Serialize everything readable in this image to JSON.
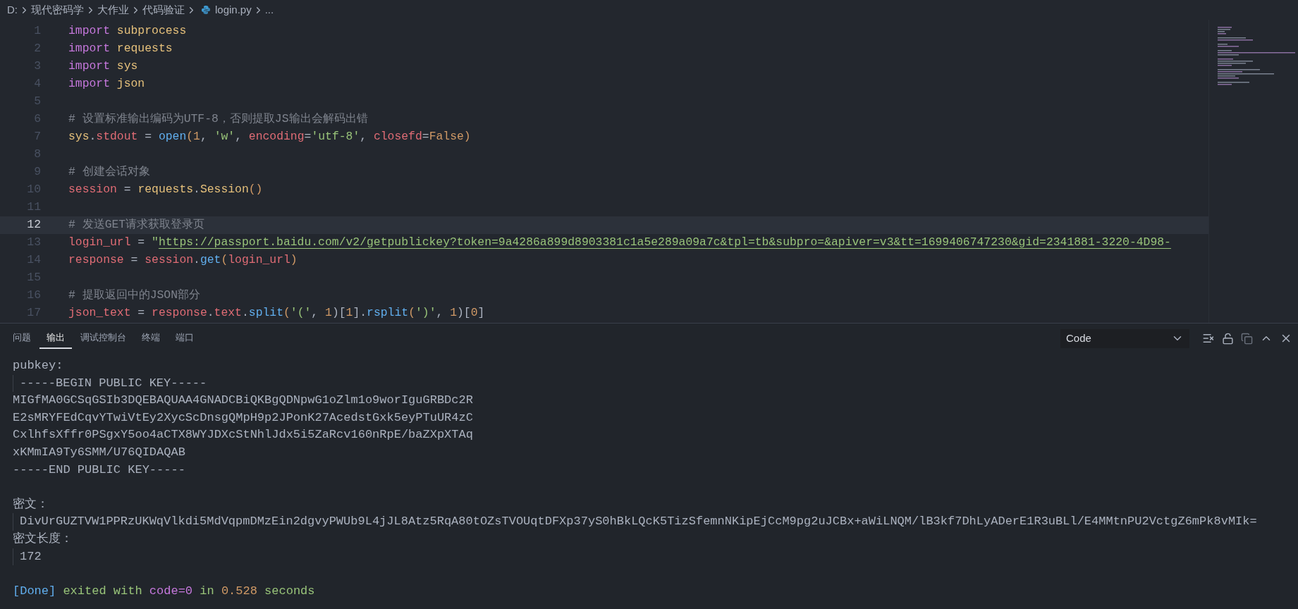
{
  "breadcrumb": [
    {
      "kind": "folder",
      "text": "D:"
    },
    {
      "kind": "folder",
      "text": "现代密码学"
    },
    {
      "kind": "folder",
      "text": "大作业"
    },
    {
      "kind": "folder",
      "text": "代码验证"
    },
    {
      "kind": "python-file",
      "text": "login.py"
    },
    {
      "kind": "more",
      "text": "..."
    }
  ],
  "code_lines": [
    {
      "number": "1",
      "current": false,
      "tokens": [
        {
          "kind": "keyword",
          "text": "import "
        },
        {
          "kind": "module",
          "text": "subprocess"
        }
      ]
    },
    {
      "number": "2",
      "current": false,
      "tokens": [
        {
          "kind": "keyword",
          "text": "import "
        },
        {
          "kind": "module",
          "text": "requests"
        }
      ]
    },
    {
      "number": "3",
      "current": false,
      "tokens": [
        {
          "kind": "keyword",
          "text": "import "
        },
        {
          "kind": "module",
          "text": "sys"
        }
      ]
    },
    {
      "number": "4",
      "current": false,
      "tokens": [
        {
          "kind": "keyword",
          "text": "import "
        },
        {
          "kind": "module",
          "text": "json"
        }
      ]
    },
    {
      "number": "5",
      "current": false
    },
    {
      "number": "6",
      "current": false,
      "tokens": [
        {
          "kind": "comment",
          "text": "# 设置标准输出编码为UTF-8，否则提取JS输出会解码出错"
        }
      ]
    },
    {
      "number": "7",
      "current": false,
      "tokens": [
        {
          "kind": "module",
          "text": "sys"
        },
        {
          "kind": "plain",
          "text": "."
        },
        {
          "kind": "variable",
          "text": "stdout"
        },
        {
          "kind": "plain",
          "text": " = "
        },
        {
          "kind": "function",
          "text": "open"
        },
        {
          "kind": "bracket",
          "text": "("
        },
        {
          "kind": "number",
          "text": "1"
        },
        {
          "kind": "plain",
          "text": ", "
        },
        {
          "kind": "string",
          "text": "'w'"
        },
        {
          "kind": "plain",
          "text": ", "
        },
        {
          "kind": "variable",
          "text": "encoding"
        },
        {
          "kind": "plain",
          "text": "="
        },
        {
          "kind": "string",
          "text": "'utf-8'"
        },
        {
          "kind": "plain",
          "text": ", "
        },
        {
          "kind": "variable",
          "text": "closefd"
        },
        {
          "kind": "plain",
          "text": "="
        },
        {
          "kind": "number",
          "text": "False"
        },
        {
          "kind": "bracket",
          "text": ")"
        }
      ]
    },
    {
      "number": "8",
      "current": false
    },
    {
      "number": "9",
      "current": false,
      "tokens": [
        {
          "kind": "comment",
          "text": "# 创建会话对象"
        }
      ]
    },
    {
      "number": "10",
      "current": false,
      "tokens": [
        {
          "kind": "variable",
          "text": "session"
        },
        {
          "kind": "plain",
          "text": " = "
        },
        {
          "kind": "module",
          "text": "requests"
        },
        {
          "kind": "plain",
          "text": "."
        },
        {
          "kind": "module",
          "text": "Session"
        },
        {
          "kind": "bracket",
          "text": "()"
        }
      ]
    },
    {
      "number": "11",
      "current": false
    },
    {
      "number": "12",
      "current": true,
      "tokens": [
        {
          "kind": "comment",
          "text": "# 发送GET请求获取登录页"
        }
      ]
    },
    {
      "number": "13",
      "current": false,
      "tokens": [
        {
          "kind": "variable",
          "text": "login_url"
        },
        {
          "kind": "plain",
          "text": " = "
        },
        {
          "kind": "string",
          "text": "\""
        },
        {
          "kind": "link",
          "text": "https://passport.baidu.com/v2/getpublickey?token=9a4286a899d8903381c1a5e289a09a7c&tpl=tb&subpro=&apiver=v3&tt=1699406747230&gid=2341881-3220-4D98-"
        }
      ]
    },
    {
      "number": "14",
      "current": false,
      "tokens": [
        {
          "kind": "variable",
          "text": "response"
        },
        {
          "kind": "plain",
          "text": " = "
        },
        {
          "kind": "variable",
          "text": "session"
        },
        {
          "kind": "plain",
          "text": "."
        },
        {
          "kind": "function",
          "text": "get"
        },
        {
          "kind": "bracket",
          "text": "("
        },
        {
          "kind": "variable",
          "text": "login_url"
        },
        {
          "kind": "bracket",
          "text": ")"
        }
      ]
    },
    {
      "number": "15",
      "current": false
    },
    {
      "number": "16",
      "current": false,
      "tokens": [
        {
          "kind": "comment",
          "text": "# 提取返回中的JSON部分"
        }
      ]
    },
    {
      "number": "17",
      "current": false,
      "tokens": [
        {
          "kind": "variable",
          "text": "json_text"
        },
        {
          "kind": "plain",
          "text": " = "
        },
        {
          "kind": "variable",
          "text": "response"
        },
        {
          "kind": "plain",
          "text": "."
        },
        {
          "kind": "variable",
          "text": "text"
        },
        {
          "kind": "plain",
          "text": "."
        },
        {
          "kind": "function",
          "text": "split"
        },
        {
          "kind": "bracket",
          "text": "("
        },
        {
          "kind": "string",
          "text": "'('"
        },
        {
          "kind": "plain",
          "text": ", "
        },
        {
          "kind": "number",
          "text": "1"
        },
        {
          "kind": "plain",
          "text": ")["
        },
        {
          "kind": "number",
          "text": "1"
        },
        {
          "kind": "plain",
          "text": "]."
        },
        {
          "kind": "function",
          "text": "rsplit"
        },
        {
          "kind": "bracket",
          "text": "("
        },
        {
          "kind": "string",
          "text": "')'"
        },
        {
          "kind": "plain",
          "text": ", "
        },
        {
          "kind": "number",
          "text": "1"
        },
        {
          "kind": "plain",
          "text": ")["
        },
        {
          "kind": "number",
          "text": "0"
        },
        {
          "kind": "plain",
          "text": "]"
        }
      ]
    }
  ],
  "panel_tabs": [
    {
      "label": "问题",
      "selected": false
    },
    {
      "label": "输出",
      "selected": true
    },
    {
      "label": "调试控制台",
      "selected": false
    },
    {
      "label": "终端",
      "selected": false
    },
    {
      "label": "端口",
      "selected": false
    }
  ],
  "output_channel": {
    "value": "Code"
  },
  "output_lines": [
    {
      "guide": false,
      "tokens": [
        {
          "kind": "plain",
          "text": "pubkey:"
        }
      ]
    },
    {
      "guide": true,
      "tokens": [
        {
          "kind": "plain",
          "text": "-----BEGIN PUBLIC KEY-----"
        }
      ]
    },
    {
      "guide": false,
      "tokens": [
        {
          "kind": "plain",
          "text": "MIGfMA0GCSqGSIb3DQEBAQUAA4GNADCBiQKBgQDNpwG1oZlm1o9worIguGRBDc2R"
        }
      ]
    },
    {
      "guide": false,
      "tokens": [
        {
          "kind": "plain",
          "text": "E2sMRYFEdCqvYTwiVtEy2XycScDnsgQMpH9p2JPonK27AcedstGxk5eyPTuUR4zC"
        }
      ]
    },
    {
      "guide": false,
      "tokens": [
        {
          "kind": "plain",
          "text": "CxlhfsXffr0PSgxY5oo4aCTX8WYJDXcStNhlJdx5i5ZaRcv160nRpE/baZXpXTAq"
        }
      ]
    },
    {
      "guide": false,
      "tokens": [
        {
          "kind": "plain",
          "text": "xKMmIA9Ty6SMM/U76QIDAQAB"
        }
      ]
    },
    {
      "guide": false,
      "tokens": [
        {
          "kind": "plain",
          "text": "-----END PUBLIC KEY-----"
        }
      ]
    },
    {
      "kind": "blank"
    },
    {
      "guide": false,
      "tokens": [
        {
          "kind": "plain",
          "text": "密文："
        }
      ]
    },
    {
      "guide": true,
      "tokens": [
        {
          "kind": "plain",
          "text": "DivUrGUZTVW1PPRzUKWqVlkdi5MdVqpmDMzEin2dgvyPWUb9L4jJL8Atz5RqA80tOZsTVOUqtDFXp37yS0hBkLQcK5TizSfemnNKipEjCcM9pg2uJCBx+aWiLNQM/lB3kf7DhLyADerE1R3uBLl/E4MMtnPU2VctgZ6mPk8vMIk="
        }
      ]
    },
    {
      "guide": false,
      "tokens": [
        {
          "kind": "plain",
          "text": "密文长度："
        }
      ]
    },
    {
      "guide": true,
      "tokens": [
        {
          "kind": "plain",
          "text": "172"
        }
      ]
    },
    {
      "kind": "blank"
    },
    {
      "guide": false,
      "tokens": [
        {
          "kind": "info",
          "text": "[Done]"
        },
        {
          "kind": "success",
          "text": " exited with "
        },
        {
          "kind": "keyword",
          "text": "code=0"
        },
        {
          "kind": "success",
          "text": " in "
        },
        {
          "kind": "number",
          "text": "0.528"
        },
        {
          "kind": "success",
          "text": " seconds"
        }
      ]
    }
  ]
}
